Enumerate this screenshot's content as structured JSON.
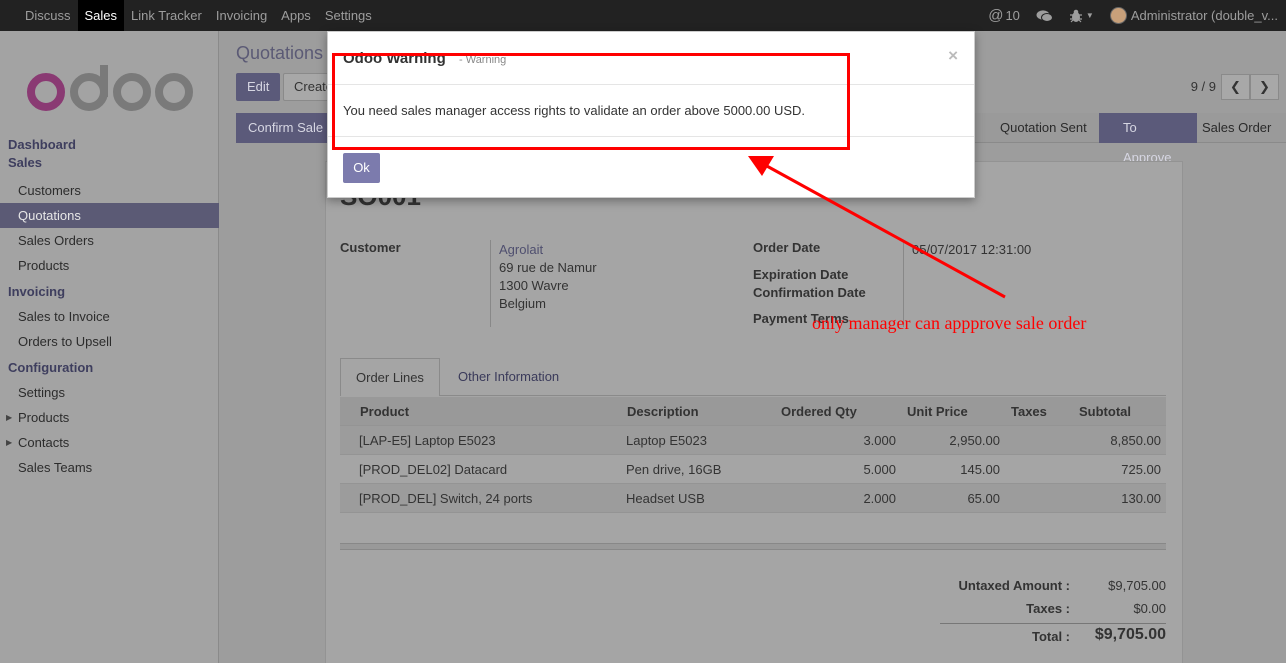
{
  "topbar": {
    "menu": [
      "Discuss",
      "Sales",
      "Link Tracker",
      "Invoicing",
      "Apps",
      "Settings"
    ],
    "active_index": 1,
    "mentions_count": "10",
    "user_name": "Administrator (double_v..."
  },
  "sidebar": {
    "logo_text": "odoo",
    "sections": [
      {
        "header": "Dashboard",
        "items": []
      },
      {
        "header": "Sales",
        "items": [
          "Customers",
          "Quotations",
          "Sales Orders",
          "Products"
        ]
      },
      {
        "header": "Invoicing",
        "items": [
          "Sales to Invoice",
          "Orders to Upsell"
        ]
      },
      {
        "header": "Configuration",
        "items": [
          "Settings",
          "Products",
          "Contacts",
          "Sales Teams"
        ]
      }
    ],
    "active_item": "Quotations"
  },
  "main": {
    "breadcrumb": "Quotations",
    "edit_label": "Edit",
    "create_label": "Create",
    "pager": "9 / 9",
    "confirm_label": "Confirm Sale",
    "stages": [
      "Quotation Sent",
      "To Approve",
      "Sales Order"
    ],
    "active_stage": "To Approve",
    "order_name": "SO001",
    "customer_label": "Customer",
    "customer": {
      "name": "Agrolait",
      "street": "69 rue de Namur",
      "city": "1300 Wavre",
      "country": "Belgium"
    },
    "order_date_label": "Order Date",
    "order_date": "05/07/2017 12:31:00",
    "expiration_label": "Expiration Date",
    "confirmation_label": "Confirmation Date",
    "payment_terms_label": "Payment Terms",
    "tabs": [
      "Order Lines",
      "Other Information"
    ],
    "lines_header": {
      "product": "Product",
      "description": "Description",
      "qty": "Ordered Qty",
      "price": "Unit Price",
      "taxes": "Taxes",
      "subtotal": "Subtotal"
    },
    "lines": [
      {
        "product": "[LAP-E5] Laptop E5023",
        "description": "Laptop E5023",
        "qty": "3.000",
        "price": "2,950.00",
        "subtotal": "8,850.00"
      },
      {
        "product": "[PROD_DEL02] Datacard",
        "description": "Pen drive, 16GB",
        "qty": "5.000",
        "price": "145.00",
        "subtotal": "725.00"
      },
      {
        "product": "[PROD_DEL] Switch, 24 ports",
        "description": "Headset USB",
        "qty": "2.000",
        "price": "65.00",
        "subtotal": "130.00"
      }
    ],
    "totals": {
      "untaxed_label": "Untaxed Amount :",
      "untaxed": "$9,705.00",
      "taxes_label": "Taxes :",
      "taxes": "$0.00",
      "total_label": "Total :",
      "total": "$9,705.00"
    }
  },
  "modal": {
    "title": "Odoo Warning",
    "subtitle": "- Warning",
    "message": "You need sales manager access rights to validate an order above 5000.00 USD.",
    "ok_label": "Ok",
    "close_glyph": "×"
  },
  "annotation": {
    "text": "only manager can appprove sale order",
    "color": "#ff0000"
  },
  "colors": {
    "accent": "#7c7bad",
    "topbar": "#222222"
  }
}
